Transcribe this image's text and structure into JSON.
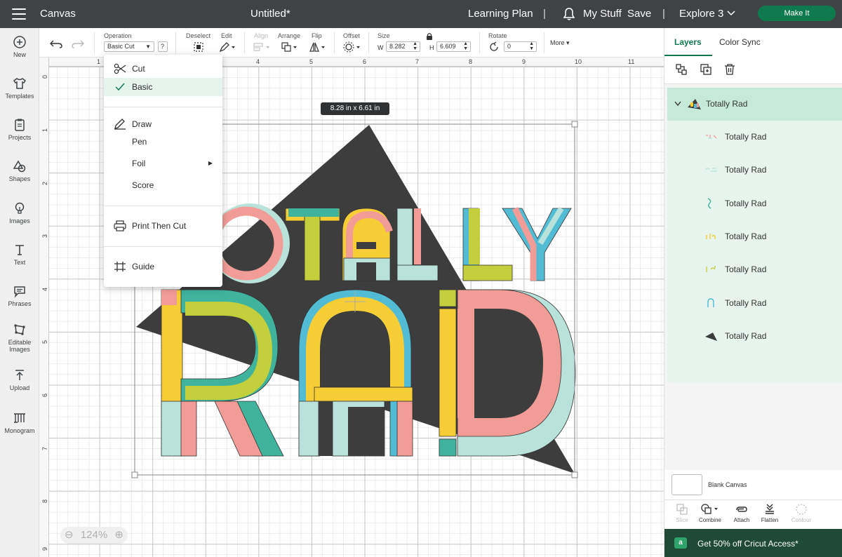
{
  "topbar": {
    "app_title": "Canvas",
    "doc_title": "Untitled*",
    "learning_plan": "Learning Plan",
    "sep": "|",
    "my_stuff": "My Stuff",
    "save": "Save",
    "machine": "Explore 3",
    "make_it": "Make It"
  },
  "sidebar": {
    "items": [
      {
        "label": "New",
        "icon": "plus-circle-icon"
      },
      {
        "label": "Templates",
        "icon": "shirt-icon"
      },
      {
        "label": "Projects",
        "icon": "clipboard-icon"
      },
      {
        "label": "Shapes",
        "icon": "shapes-icon"
      },
      {
        "label": "Images",
        "icon": "bulb-icon"
      },
      {
        "label": "Text",
        "icon": "text-icon"
      },
      {
        "label": "Phrases",
        "icon": "speech-bubble-icon"
      },
      {
        "label": "Editable Images",
        "icon": "editable-image-icon"
      },
      {
        "label": "Upload",
        "icon": "upload-icon"
      },
      {
        "label": "Monogram",
        "icon": "monogram-icon"
      }
    ]
  },
  "toolbar": {
    "operation_label": "Operation",
    "operation_value": "Basic Cut",
    "help": "?",
    "deselect_label": "Deselect",
    "edit_label": "Edit",
    "align_label": "Align",
    "arrange_label": "Arrange",
    "flip_label": "Flip",
    "offset_label": "Offset",
    "size_label": "Size",
    "w_label": "W",
    "w_value": "8.282",
    "h_label": "H",
    "h_value": "6.609",
    "rotate_label": "Rotate",
    "rotate_value": "0",
    "more_label": "More"
  },
  "ruler": {
    "top": [
      "1",
      "2",
      "3",
      "4",
      "5",
      "6",
      "7",
      "8",
      "9",
      "10",
      "11"
    ],
    "left": [
      "0",
      "1",
      "2",
      "3",
      "4",
      "5",
      "6",
      "7",
      "8",
      "9"
    ]
  },
  "canvas": {
    "size_tooltip": "8.28  in x 6.61  in",
    "zoom": "124%",
    "colors": {
      "dark": "#3d3d3d",
      "pink": "#f29c97",
      "mint": "#b9e2da",
      "teal": "#3fb39c",
      "yellow": "#f7cd36",
      "lime": "#c3cf3c",
      "blue": "#53bcd5"
    }
  },
  "operation_menu": {
    "cut_header": "Cut",
    "basic": "Basic",
    "draw_header": "Draw",
    "pen": "Pen",
    "foil": "Foil",
    "score": "Score",
    "print_then_cut": "Print Then Cut",
    "guide": "Guide"
  },
  "right_panel": {
    "tab_layers": "Layers",
    "tab_color_sync": "Color Sync",
    "group_label": "Totally Rad",
    "layers": [
      {
        "label": "Totally Rad"
      },
      {
        "label": "Totally Rad"
      },
      {
        "label": "Totally Rad"
      },
      {
        "label": "Totally Rad"
      },
      {
        "label": "Totally Rad"
      },
      {
        "label": "Totally Rad"
      },
      {
        "label": "Totally Rad"
      }
    ],
    "blank_canvas": "Blank Canvas",
    "actions": {
      "slice": "Slice",
      "combine": "Combine",
      "attach": "Attach",
      "flatten": "Flatten",
      "contour": "Contour"
    },
    "promo": "Get 50% off Cricut Access*",
    "promo_icon_letter": "a"
  }
}
